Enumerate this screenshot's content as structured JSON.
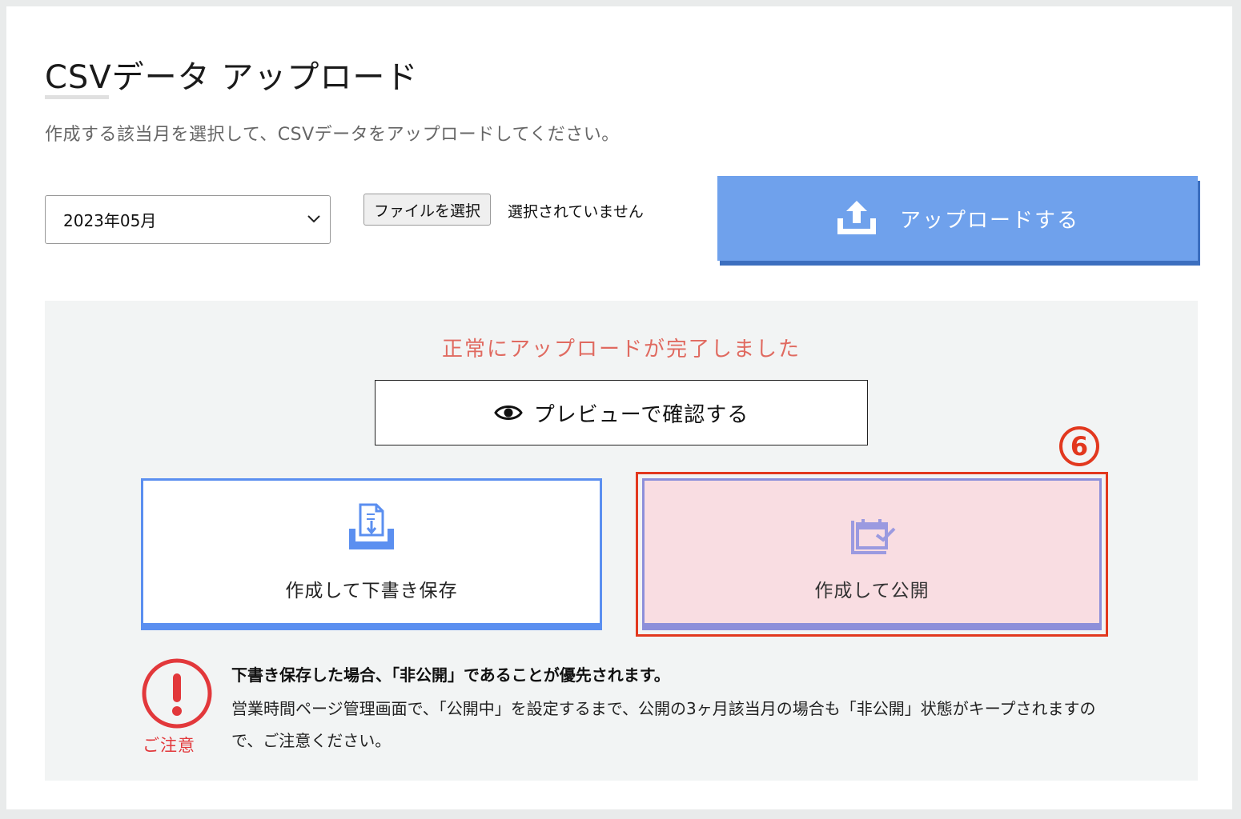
{
  "header": {
    "title": "CSVデータ アップロード",
    "subtitle": "作成する該当月を選択して、CSVデータをアップロードしてください。"
  },
  "form": {
    "month_select": {
      "value": "2023年05月"
    },
    "file_button_label": "ファイルを選択",
    "file_status": "選択されていません",
    "upload_button_label": "アップロードする"
  },
  "result": {
    "success_message": "正常にアップロードが完了しました",
    "preview_button_label": "プレビューで確認する",
    "draft_button_label": "作成して下書き保存",
    "publish_button_label": "作成して公開",
    "step_badge": "6"
  },
  "notice": {
    "icon_label": "ご注意",
    "title": "下書き保存した場合、「非公開」であることが優先されます。",
    "body": "営業時間ページ管理画面で、「公開中」を設定するまで、公開の3ヶ月該当月の場合も「非公開」状態がキープされますので、ご注意ください。"
  },
  "colors": {
    "upload_button": "#6fa1ec",
    "success_text": "#e06a60",
    "draft_border": "#5b8ff0",
    "publish_bg": "#f9dde2",
    "publish_border": "#8d8fda",
    "highlight_frame": "#e2381e",
    "caution": "#e2383b"
  },
  "icons": [
    "chevron-down-icon",
    "upload-icon",
    "eye-icon",
    "draft-save-icon",
    "publish-calendar-icon",
    "exclamation-icon"
  ]
}
